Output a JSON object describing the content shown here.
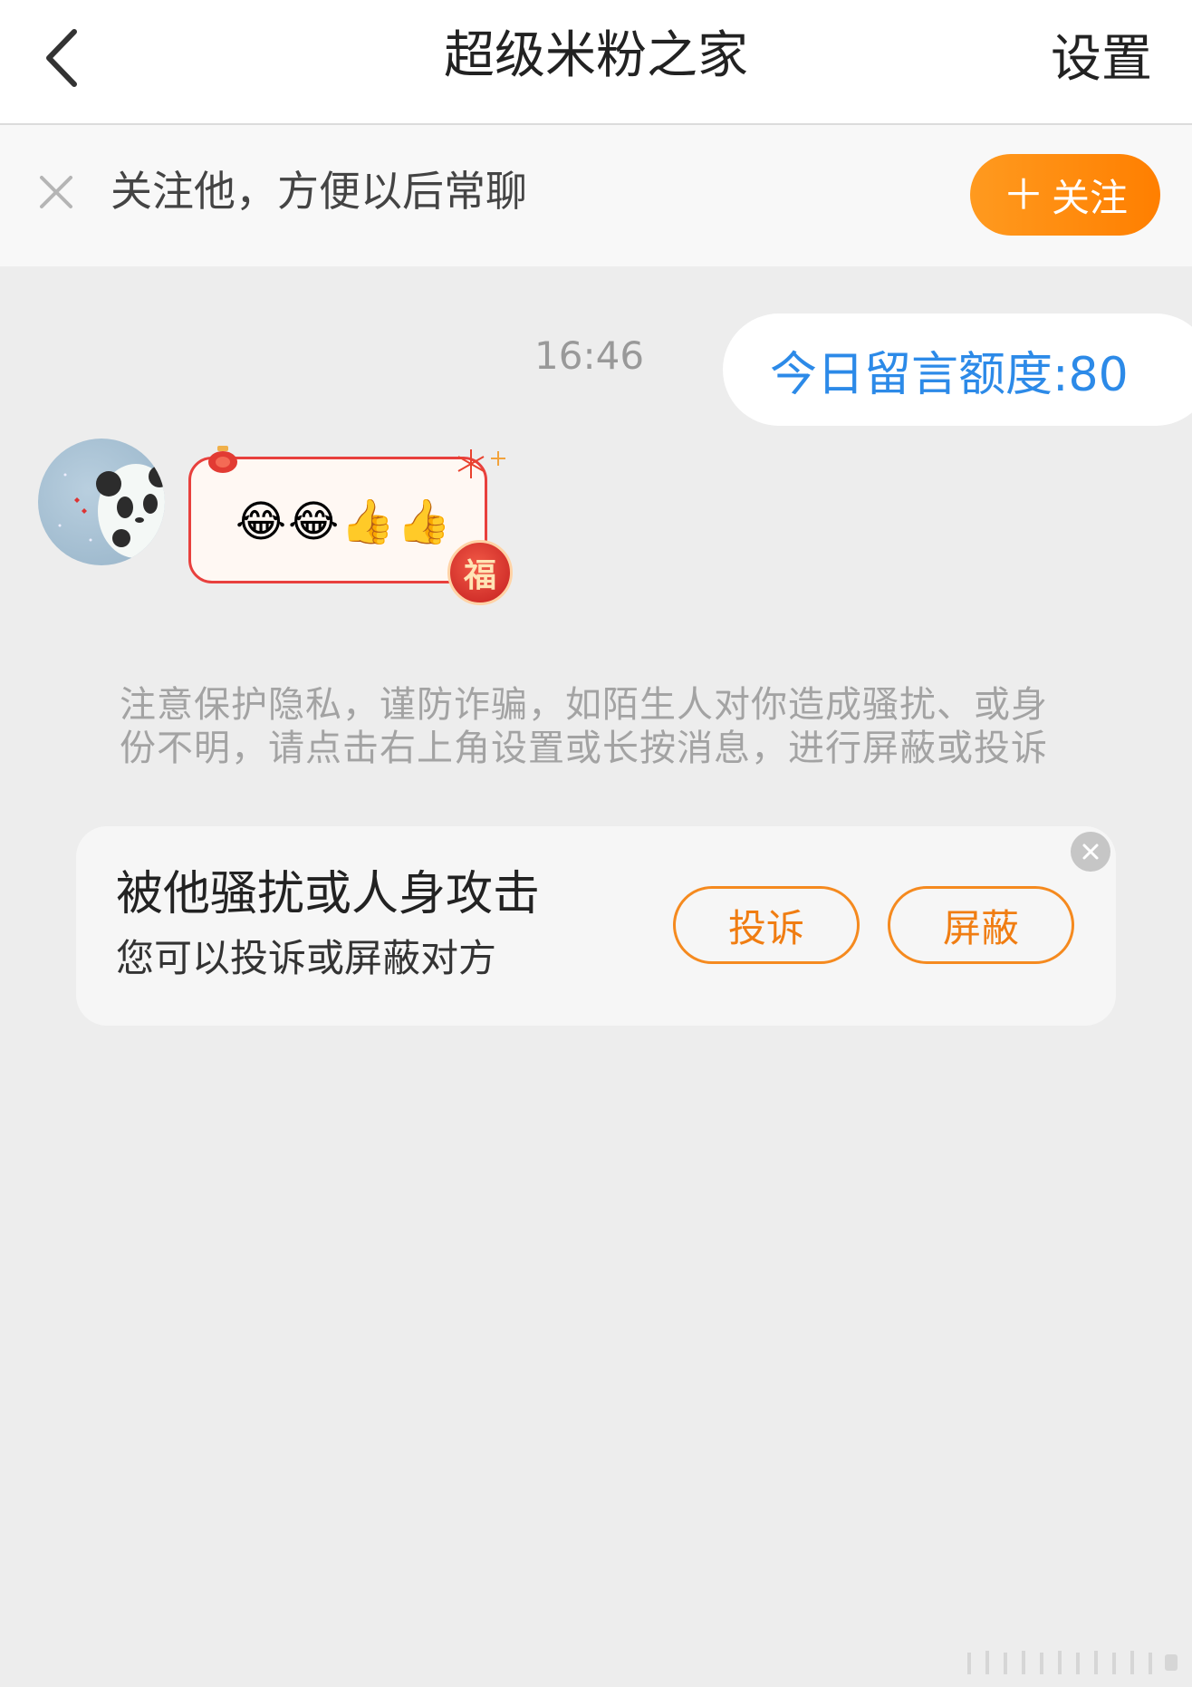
{
  "header": {
    "title": "超级米粉之家",
    "settings_label": "设置"
  },
  "follow_bar": {
    "text": "关注他，方便以后常聊",
    "button_label": "关注"
  },
  "chat": {
    "timestamp": "16:46",
    "outgoing_message": "今日留言额度:80",
    "incoming_sticker_emojis": [
      "😂",
      "😂",
      "👍",
      "👍"
    ],
    "sticker_badge": "福"
  },
  "notice": {
    "text": "注意保护隐私，谨防诈骗，如陌生人对你造成骚扰、或身份不明，请点击右上角设置或长按消息，进行屏蔽或投诉"
  },
  "report_card": {
    "title": "被他骚扰或人身攻击",
    "subtitle": "您可以投诉或屏蔽对方",
    "report_label": "投诉",
    "block_label": "屏蔽"
  },
  "colors": {
    "accent_orange": "#ff8a0d",
    "message_blue": "#2c8ae8",
    "background": "#ededed"
  }
}
